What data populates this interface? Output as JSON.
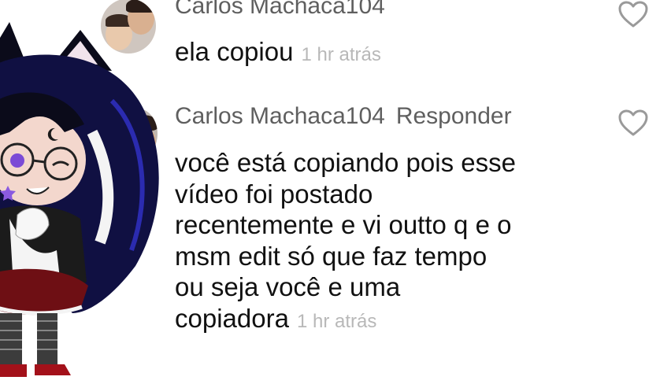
{
  "comments": [
    {
      "username": "Carlos Machaca104",
      "text": "ela copiou",
      "timestamp": "1 hr atrás"
    },
    {
      "username": "Carlos Machaca104",
      "reply_label": "Responder",
      "lines": [
        "você está copiando pois esse",
        "vídeo foi postado",
        "recentemente e vi outto q e o",
        "msm edit só que faz tempo",
        "ou seja você e uma",
        "copiadora"
      ],
      "timestamp": "1 hr atrás"
    }
  ],
  "icons": {
    "like": "heart-outline-icon"
  },
  "colors": {
    "username": "#5f5f5f",
    "timestamp": "#b8b8b8",
    "text": "#111111",
    "heart": "#9a9a9a"
  }
}
